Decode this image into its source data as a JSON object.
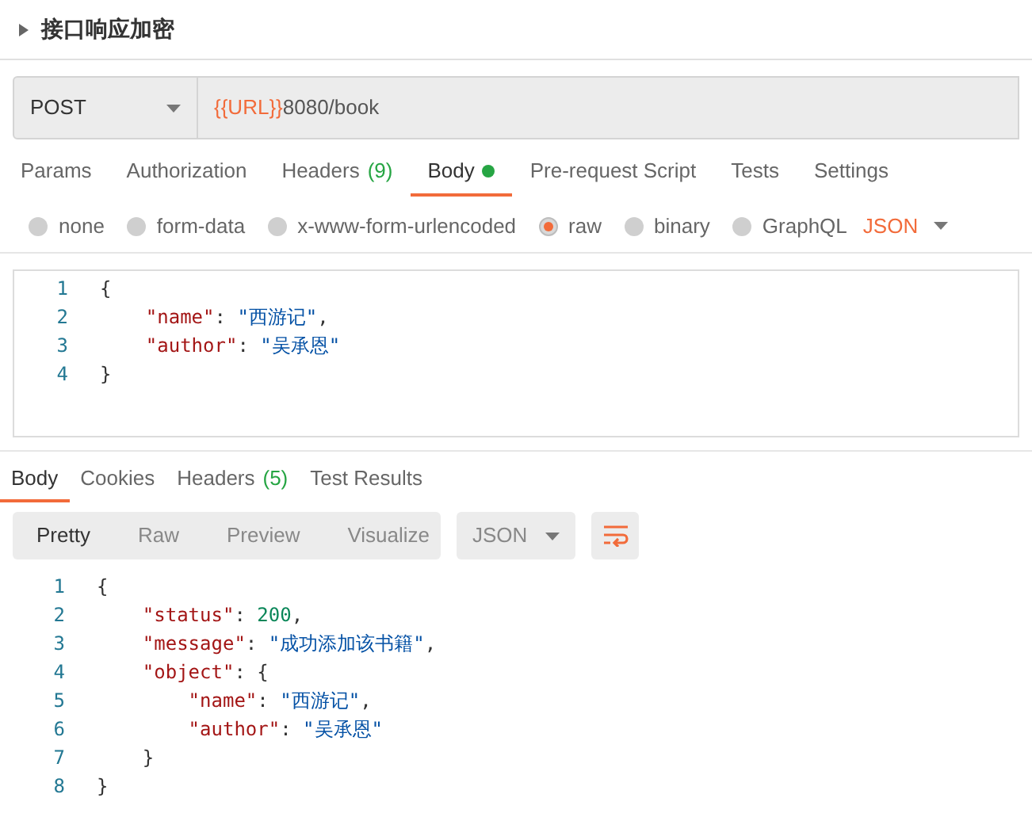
{
  "request": {
    "title": "接口响应加密",
    "expanded": false
  },
  "url_bar": {
    "method": "POST",
    "variable": "{{URL}}",
    "path": "8080/book"
  },
  "request_tabs": [
    {
      "label": "Params",
      "selected": false
    },
    {
      "label": "Authorization",
      "selected": false
    },
    {
      "label": "Headers",
      "count": "(9)",
      "selected": false
    },
    {
      "label": "Body",
      "dot": true,
      "selected": true
    },
    {
      "label": "Pre-request Script",
      "selected": false
    },
    {
      "label": "Tests",
      "selected": false
    },
    {
      "label": "Settings",
      "selected": false
    }
  ],
  "body_types": [
    {
      "label": "none",
      "selected": false
    },
    {
      "label": "form-data",
      "selected": false
    },
    {
      "label": "x-www-form-urlencoded",
      "selected": false
    },
    {
      "label": "raw",
      "selected": true
    },
    {
      "label": "binary",
      "selected": false
    },
    {
      "label": "GraphQL",
      "selected": false
    }
  ],
  "body_format": "JSON",
  "request_body": [
    {
      "number": "1",
      "tokens": [
        {
          "kind": "punct",
          "text": "{"
        }
      ]
    },
    {
      "number": "2",
      "tokens": [
        {
          "kind": "key",
          "text": "    \"name\""
        },
        {
          "kind": "punct",
          "text": ": "
        },
        {
          "kind": "string",
          "text": "\"西游记\""
        },
        {
          "kind": "punct",
          "text": ","
        }
      ]
    },
    {
      "number": "3",
      "tokens": [
        {
          "kind": "key",
          "text": "    \"author\""
        },
        {
          "kind": "punct",
          "text": ": "
        },
        {
          "kind": "string",
          "text": "\"吴承恩\""
        }
      ]
    },
    {
      "number": "4",
      "tokens": [
        {
          "kind": "punct",
          "text": "}"
        }
      ]
    }
  ],
  "response_tabs": [
    {
      "label": "Body",
      "selected": true
    },
    {
      "label": "Cookies",
      "selected": false
    },
    {
      "label": "Headers",
      "count": "(5)",
      "selected": false
    },
    {
      "label": "Test Results",
      "selected": false
    }
  ],
  "view_modes": [
    {
      "label": "Pretty",
      "selected": true
    },
    {
      "label": "Raw",
      "selected": false
    },
    {
      "label": "Preview",
      "selected": false
    },
    {
      "label": "Visualize",
      "selected": false
    }
  ],
  "response_format": "JSON",
  "response_body": [
    {
      "number": "1",
      "tokens": [
        {
          "kind": "punct",
          "text": "{"
        }
      ]
    },
    {
      "number": "2",
      "tokens": [
        {
          "kind": "key",
          "text": "    \"status\""
        },
        {
          "kind": "punct",
          "text": ": "
        },
        {
          "kind": "number",
          "text": "200"
        },
        {
          "kind": "punct",
          "text": ","
        }
      ]
    },
    {
      "number": "3",
      "tokens": [
        {
          "kind": "key",
          "text": "    \"message\""
        },
        {
          "kind": "punct",
          "text": ": "
        },
        {
          "kind": "string",
          "text": "\"成功添加该书籍\""
        },
        {
          "kind": "punct",
          "text": ","
        }
      ]
    },
    {
      "number": "4",
      "tokens": [
        {
          "kind": "key",
          "text": "    \"object\""
        },
        {
          "kind": "punct",
          "text": ": {"
        }
      ]
    },
    {
      "number": "5",
      "tokens": [
        {
          "kind": "key",
          "text": "        \"name\""
        },
        {
          "kind": "punct",
          "text": ": "
        },
        {
          "kind": "string",
          "text": "\"西游记\""
        },
        {
          "kind": "punct",
          "text": ","
        }
      ]
    },
    {
      "number": "6",
      "tokens": [
        {
          "kind": "key",
          "text": "        \"author\""
        },
        {
          "kind": "punct",
          "text": ": "
        },
        {
          "kind": "string",
          "text": "\"吴承恩\""
        }
      ]
    },
    {
      "number": "7",
      "tokens": [
        {
          "kind": "punct",
          "text": "    }"
        }
      ]
    },
    {
      "number": "8",
      "tokens": [
        {
          "kind": "punct",
          "text": "}"
        }
      ]
    }
  ]
}
